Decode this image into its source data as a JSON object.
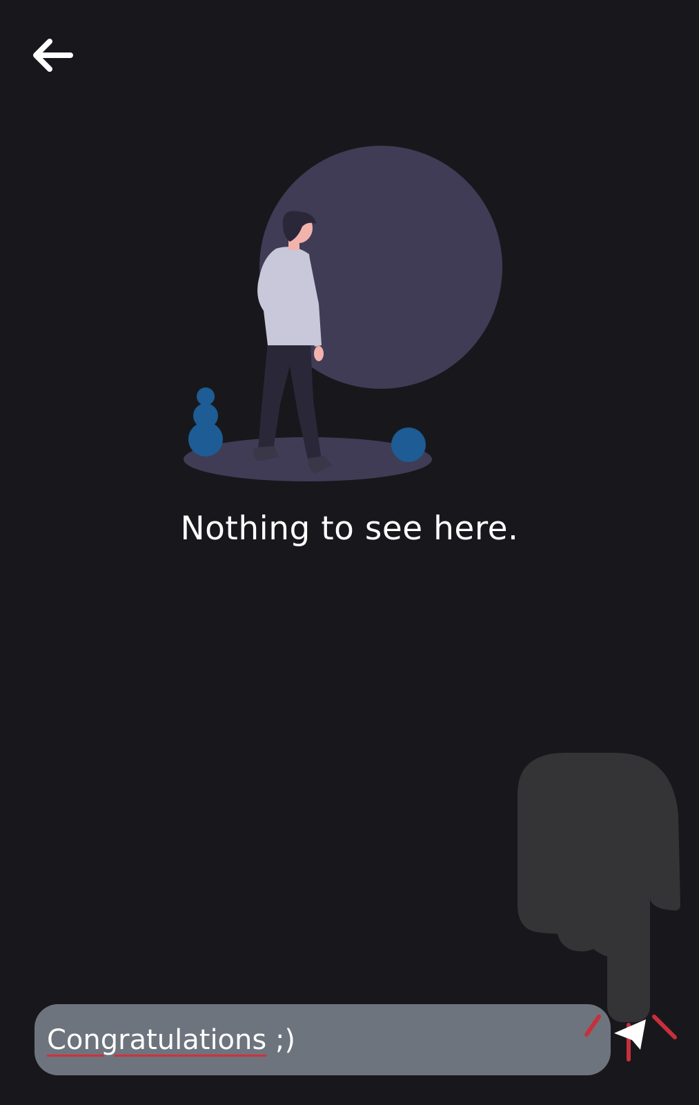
{
  "header": {
    "back_icon": "arrow-left-icon"
  },
  "empty_state": {
    "text": "Nothing to see here."
  },
  "composer": {
    "message_word": "Congratulations",
    "message_rest": " ;)",
    "send_icon": "send-icon"
  },
  "colors": {
    "background": "#18181c",
    "illustration_circle": "#403c56",
    "accent_blue": "#1d5c94",
    "input_bg": "#6d747d",
    "spellcheck_red": "#d32f3a"
  }
}
